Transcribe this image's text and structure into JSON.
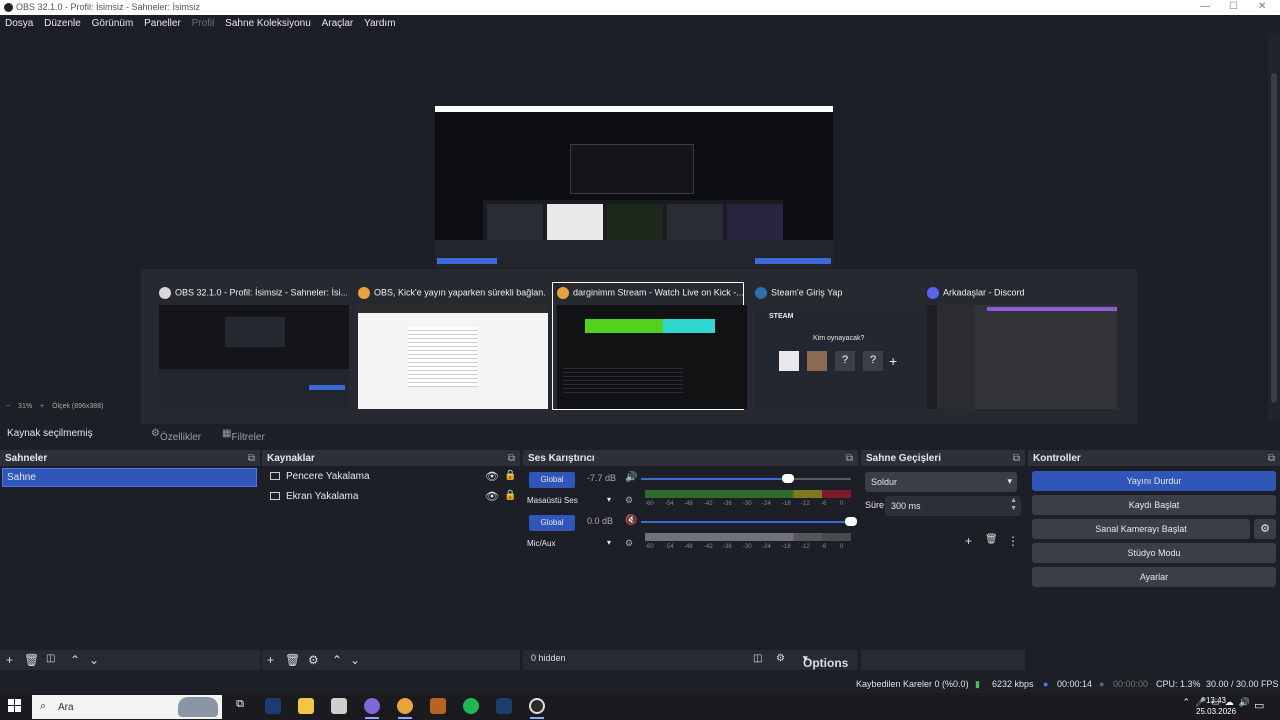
{
  "window": {
    "title": "OBS 32.1.0 - Profil: İsimsiz - Sahneler: İsimsiz"
  },
  "menu": [
    "Dosya",
    "Düzenle",
    "Görünüm",
    "Paneller",
    "Profil",
    "Sahne Koleksiyonu",
    "Araçlar",
    "Yardım"
  ],
  "task_switcher": [
    {
      "title": "OBS 32.1.0 - Profil: İsimsiz - Sahneler: İsi...",
      "icon": "obs-icon",
      "color": "#d8d8d8"
    },
    {
      "title": "OBS, Kick'e yayın yaparken sürekli bağlan...",
      "icon": "chrome-icon",
      "color": "#e8a33d"
    },
    {
      "title": "darginimm Stream - Watch Live on Kick -...",
      "icon": "chrome-icon",
      "color": "#e8a33d"
    },
    {
      "title": "Steam'e Giriş Yap",
      "icon": "steam-icon",
      "color": "#2a6fb0"
    },
    {
      "title": "Arkadaşlar - Discord",
      "icon": "discord-icon",
      "color": "#5865f2"
    }
  ],
  "steam_thumb": {
    "brand": "STEAM",
    "prompt": "Kim oynayacak?"
  },
  "zoom": {
    "level": "31%",
    "scale": "Ölçek (896x388)"
  },
  "source_toolbar": {
    "status": "Kaynak seçilmemiş",
    "properties": "Özellikler",
    "filters": "Filtreler"
  },
  "docks": {
    "scenes": {
      "title": "Sahneler",
      "items": [
        "Sahne"
      ]
    },
    "sources": {
      "title": "Kaynaklar",
      "items": [
        "Pencere Yakalama",
        "Ekran Yakalama"
      ]
    },
    "mixer": {
      "title": "Ses Karıştırıcı",
      "channels": [
        {
          "name": "Masaüstü Ses",
          "db": "-7.7 dB",
          "group": "Global",
          "level": 0.7,
          "muted": false
        },
        {
          "name": "Mic/Aux",
          "db": "0.0 dB",
          "group": "Global",
          "level": 1.0,
          "muted": true
        }
      ],
      "ticks": [
        "-60",
        "-54",
        "-48",
        "-42",
        "-36",
        "-30",
        "-24",
        "-18",
        "-12",
        "-6",
        "0"
      ],
      "hidden": "0 hidden",
      "options": "Options"
    },
    "transitions": {
      "title": "Sahne Geçişleri",
      "selected": "Soldur",
      "duration_label": "Süre",
      "duration": "300 ms"
    },
    "controls": {
      "title": "Kontroller",
      "buttons": [
        "Yayını Durdur",
        "Kaydı Başlat",
        "Sanal Kamerayı Başlat",
        "Stüdyo Modu",
        "Ayarlar"
      ]
    }
  },
  "status": {
    "dropped": "Kaybedilen Kareler 0 (%0.0)",
    "bitrate": "6232 kbps",
    "stream_time": "00:00:14",
    "rec_time": "00:00:00",
    "cpu": "CPU: 1.3%",
    "fps": "30.00 / 30.00 FPS"
  },
  "taskbar": {
    "search_placeholder": "Ara",
    "time": "13:43",
    "date": "25.03.2026"
  },
  "colors": {
    "accent": "#2f56b8",
    "bg": "#1d1f26",
    "panel": "#272a33"
  }
}
